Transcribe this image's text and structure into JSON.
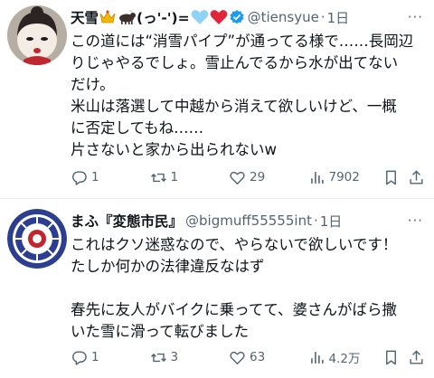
{
  "tweets": [
    {
      "name": "天雪",
      "name_suffix": "(っ'-')=",
      "emoji": [
        "crown-emoji",
        "ox-emoji",
        "light-blue-heart-emoji",
        "red-heart-emoji"
      ],
      "verified": true,
      "handle": "@tiensyue",
      "time": "1日",
      "body": [
        "この道には“消雪パイプ”が通ってる様で……長岡辺",
        "りじゃやるでしょ。雪止んでるから水が出てない",
        "だけ。",
        "米山は落選して中越から消えて欲しいけど、一概",
        "に否定してもね……",
        "片さないと家から出られないw"
      ],
      "replies": "1",
      "retweets": "1",
      "likes": "29",
      "views": "7902"
    },
    {
      "name": "まふ『変態市民』",
      "handle": "@bigmuff55555int",
      "time": "1日",
      "body": [
        "これはクソ迷惑なので、やらないで欲しいです！",
        "たしか何かの法律違反なはず",
        "",
        "春先に友人がバイクに乗ってて、婆さんがばら撒",
        "いた雪に滑って転びました"
      ],
      "replies": "1",
      "retweets": "3",
      "likes": "63",
      "views": "4.2万"
    }
  ],
  "colors": {
    "text": "#0f1419",
    "muted": "#536471",
    "verified": "#1d9bf0",
    "divider": "#e6ecf0"
  }
}
